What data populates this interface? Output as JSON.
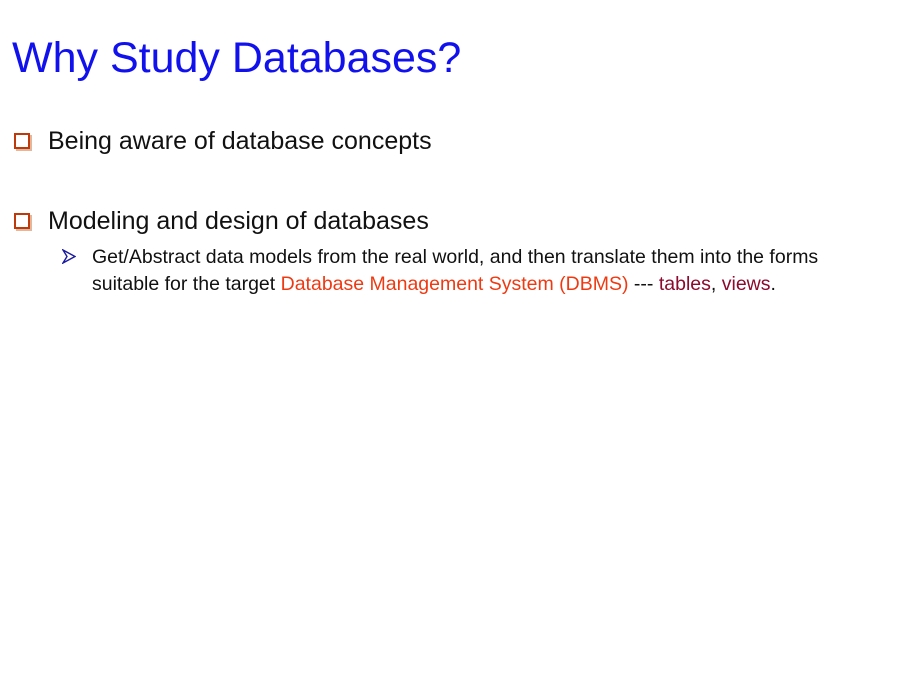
{
  "slide": {
    "title": "Why Study Databases?",
    "bullets": [
      {
        "text": "Being aware of database concepts",
        "icon": "square-bullet-icon"
      },
      {
        "text": "Modeling and design of databases",
        "icon": "square-bullet-icon",
        "sub_bullets": [
          {
            "icon": "arrow-bullet-icon",
            "part1": "Get/Abstract data models from the real world, and then translate them into the forms suitable for the target ",
            "highlight1": "Database Management System (DBMS)",
            "part2": " --- ",
            "highlight2": "tables",
            "part3": ", ",
            "highlight3": "views",
            "part4": "."
          }
        ]
      }
    ]
  },
  "colors": {
    "title": "#1111ee",
    "bullet_square": "#c0390b",
    "arrow": "#1a1aa0",
    "highlight_orange": "#ee3a12",
    "highlight_maroon": "#8b0a2e",
    "text": "#111111"
  }
}
